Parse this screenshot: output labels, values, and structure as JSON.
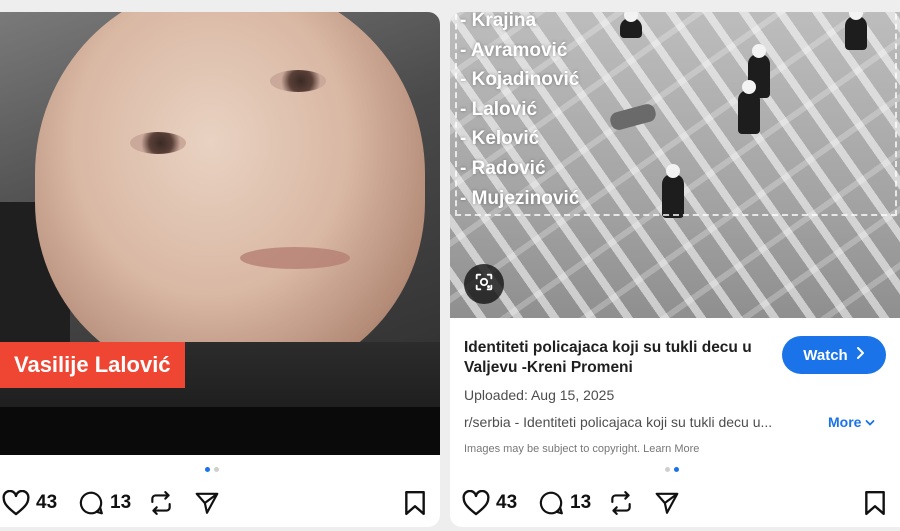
{
  "left_post": {
    "name_overlay": "Vasilije Lalović",
    "carousel": {
      "count": 2,
      "active": 1
    },
    "actions": {
      "likes": "43",
      "comments": "13"
    }
  },
  "right_post": {
    "names_list": [
      "- Krajina",
      "- Avramović",
      "- Kojadinović",
      "- Lalović",
      "- Kelović",
      "- Radović",
      "- Mujezinović"
    ],
    "result": {
      "title": "Identiteti policajaca koji su tukli decu u Valjevu -Kreni Promeni",
      "watch_label": "Watch",
      "uploaded": "Uploaded: Aug 15, 2025",
      "source": "r/serbia - Identiteti policajaca koji su tukli decu u...",
      "more_label": "More",
      "copyright": "Images may be subject to copyright. Learn More"
    },
    "carousel": {
      "count": 2,
      "active": 2
    },
    "actions": {
      "likes": "43",
      "comments": "13"
    }
  },
  "icons": [
    "heart-icon",
    "comment-icon",
    "repost-icon",
    "share-icon",
    "bookmark-icon",
    "lens-icon",
    "chevron-right-icon",
    "chevron-down-icon"
  ],
  "colors": {
    "name_tag": "#ef4533",
    "accent_blue": "#1a73e8"
  }
}
